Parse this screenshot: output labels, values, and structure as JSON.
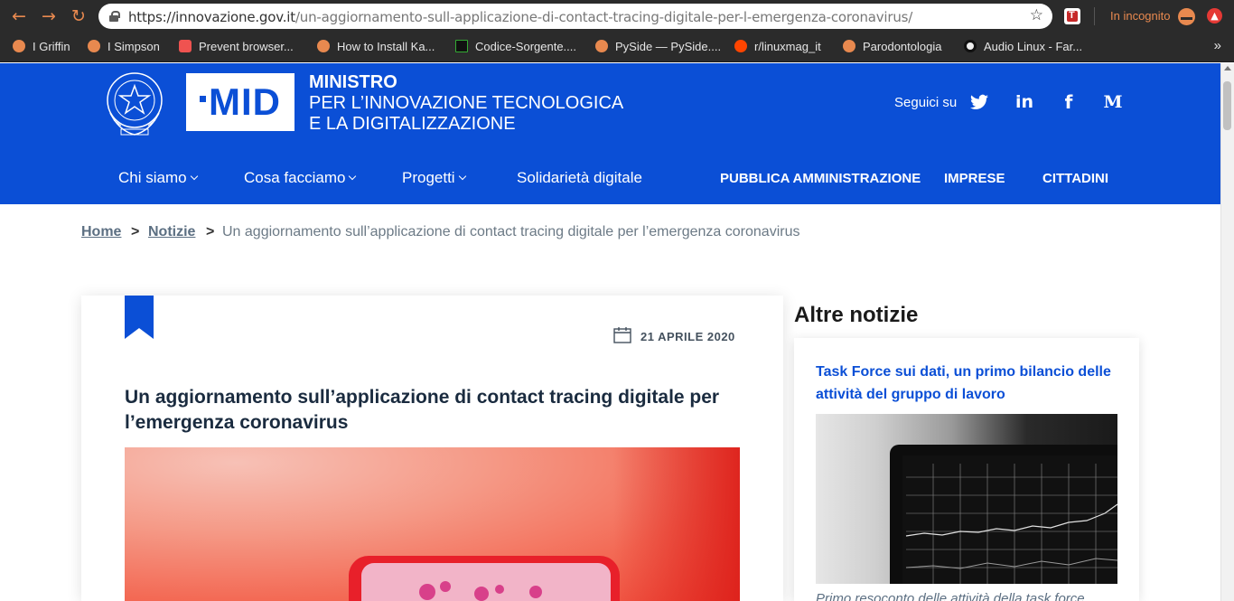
{
  "browser": {
    "url_host": "https://innovazione.gov.it",
    "url_path": "/un-aggiornamento-sull-applicazione-di-contact-tracing-digitale-per-l-emergenza-coronavirus/",
    "incognito_label": "In incognito",
    "bookmarks": [
      {
        "label": "I Griffin"
      },
      {
        "label": "I Simpson"
      },
      {
        "label": "Prevent browser..."
      },
      {
        "label": "How to Install Ka..."
      },
      {
        "label": "Codice-Sorgente...."
      },
      {
        "label": "PySide — PySide...."
      },
      {
        "label": "r/linuxmag_it"
      },
      {
        "label": "Parodontologia"
      },
      {
        "label": "Audio Linux - Far..."
      }
    ],
    "bookmarks_more": "»",
    "accent_color": "#e8894f"
  },
  "header": {
    "logo_text": "MID",
    "ministry_line1": "MINISTRO",
    "ministry_line2": "PER L’INNOVAZIONE TECNOLOGICA",
    "ministry_line3": "E LA DIGITALIZZAZIONE",
    "follow_label": "Seguici su",
    "social_linkedin": "in",
    "social_facebook": "f",
    "social_medium": "M",
    "brand_color": "#0b4fd6",
    "nav": [
      {
        "label": "Chi siamo"
      },
      {
        "label": "Cosa facciamo"
      },
      {
        "label": "Progetti"
      },
      {
        "label": "Solidarietà digitale"
      }
    ],
    "audience": [
      {
        "label": "PUBBLICA AMMINISTRAZIONE"
      },
      {
        "label": "IMPRESE"
      },
      {
        "label": "CITTADINI"
      }
    ]
  },
  "breadcrumb": {
    "home": "Home",
    "news": "Notizie",
    "separator": ">",
    "current": "Un aggiornamento sull’applicazione di contact tracing digitale per l’emergenza coronavirus"
  },
  "article": {
    "date": "21 APRILE 2020",
    "title": "Un aggiornamento sull’applicazione di contact tracing digitale per l’emergenza coronavirus"
  },
  "sidebar": {
    "title": "Altre notizie",
    "news_title": "Task Force sui dati, un primo bilancio delle attività del gruppo di lavoro",
    "news_subtitle": "Primo resoconto delle attività della task force"
  }
}
